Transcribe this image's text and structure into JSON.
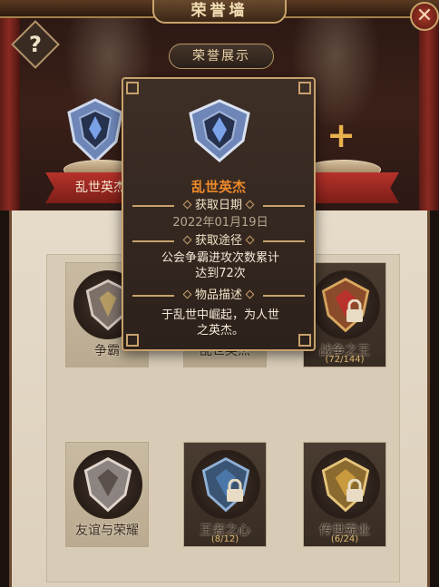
{
  "header": {
    "title": "荣誉墙",
    "section": "荣誉展示"
  },
  "controls": {
    "help_glyph": "?",
    "close_glyph": "✕"
  },
  "shelf": {
    "displayed_badge_label": "乱世英杰",
    "add_slot_glyph": "+"
  },
  "tooltip": {
    "name": "乱世英杰",
    "obtain_date_header": "获取日期",
    "obtain_date": "2022年01月19日",
    "obtain_method_header": "获取途径",
    "obtain_method_lines": [
      "公会争霸进攻次数累计",
      "达到72次"
    ],
    "description_header": "物品描述",
    "description_lines": [
      "于乱世中崛起，为人世",
      "之英杰。"
    ]
  },
  "badges": [
    {
      "label": "争霸",
      "progress": "",
      "locked": false
    },
    {
      "label": "乱世英杰",
      "progress": "",
      "locked": false
    },
    {
      "label": "战争之王",
      "progress": "(72/144)",
      "locked": true
    },
    {
      "label": "友谊与荣耀",
      "progress": "",
      "locked": false
    },
    {
      "label": "王者之心",
      "progress": "(8/12)",
      "locked": true
    },
    {
      "label": "传世霸业",
      "progress": "(6/24)",
      "locked": true
    }
  ],
  "colors": {
    "tooltip_name": "#f08a2b",
    "gold_trim": "#c8a16c",
    "ribbon_red": "#b6322a",
    "plus_gold": "#e9b24e"
  },
  "icons": [
    "help-icon",
    "close-icon",
    "plus-icon",
    "lock-icon",
    "badge-emblem-icon"
  ]
}
